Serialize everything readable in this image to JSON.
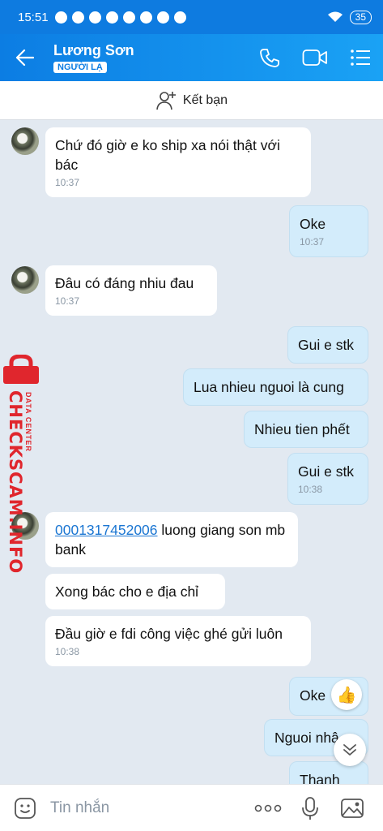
{
  "status": {
    "time": "15:51",
    "battery": "35"
  },
  "header": {
    "name": "Lương Sơn",
    "badge": "NGƯỜI LẠ"
  },
  "addfriend": {
    "label": "Kết bạn"
  },
  "watermark": {
    "brand": "CHECKSCAM.INFO",
    "sub": "DATA CENTER"
  },
  "messages": [
    {
      "from": "them",
      "text": "Chứ đó giờ e ko ship xa nói thật với bác",
      "time": "10:37"
    },
    {
      "from": "me",
      "text": "Oke",
      "time": "10:37"
    },
    {
      "from": "them",
      "text": "Đâu có đáng nhiu đau",
      "time": "10:37"
    },
    {
      "from": "me",
      "text": "Gui e stk"
    },
    {
      "from": "me",
      "text": "Lua nhieu nguoi là cung"
    },
    {
      "from": "me",
      "text": "Nhieu tien phết"
    },
    {
      "from": "me",
      "text": "Gui e stk",
      "time": "10:38"
    },
    {
      "from": "them",
      "link": "0001317452006",
      "text": " luong giang son mb bank"
    },
    {
      "from": "them",
      "text": "Xong bác cho e địa chỉ"
    },
    {
      "from": "them",
      "text": "Đầu giờ e fdi công việc ghé gửi luôn",
      "time": "10:38"
    },
    {
      "from": "me",
      "text": "Oke"
    },
    {
      "from": "me",
      "text": "Nguoi nhậ"
    },
    {
      "from": "me",
      "text": "Thanh"
    }
  ],
  "input": {
    "placeholder": "Tin nhắn"
  },
  "icons": {
    "back": "arrow-left-icon",
    "call": "phone-icon",
    "video": "video-icon",
    "menu": "list-icon",
    "add": "add-person-icon",
    "sticker": "sticker-icon",
    "more": "more-icon",
    "mic": "mic-icon",
    "image": "image-icon",
    "reaction": "thumbs-up-icon",
    "scroll": "chevron-down-icon"
  },
  "colors": {
    "header": "#0e7be0",
    "bubble_me": "#d3ecfb",
    "bubble_them": "#ffffff",
    "background": "#e2e9f1",
    "watermark": "#e0262d"
  }
}
